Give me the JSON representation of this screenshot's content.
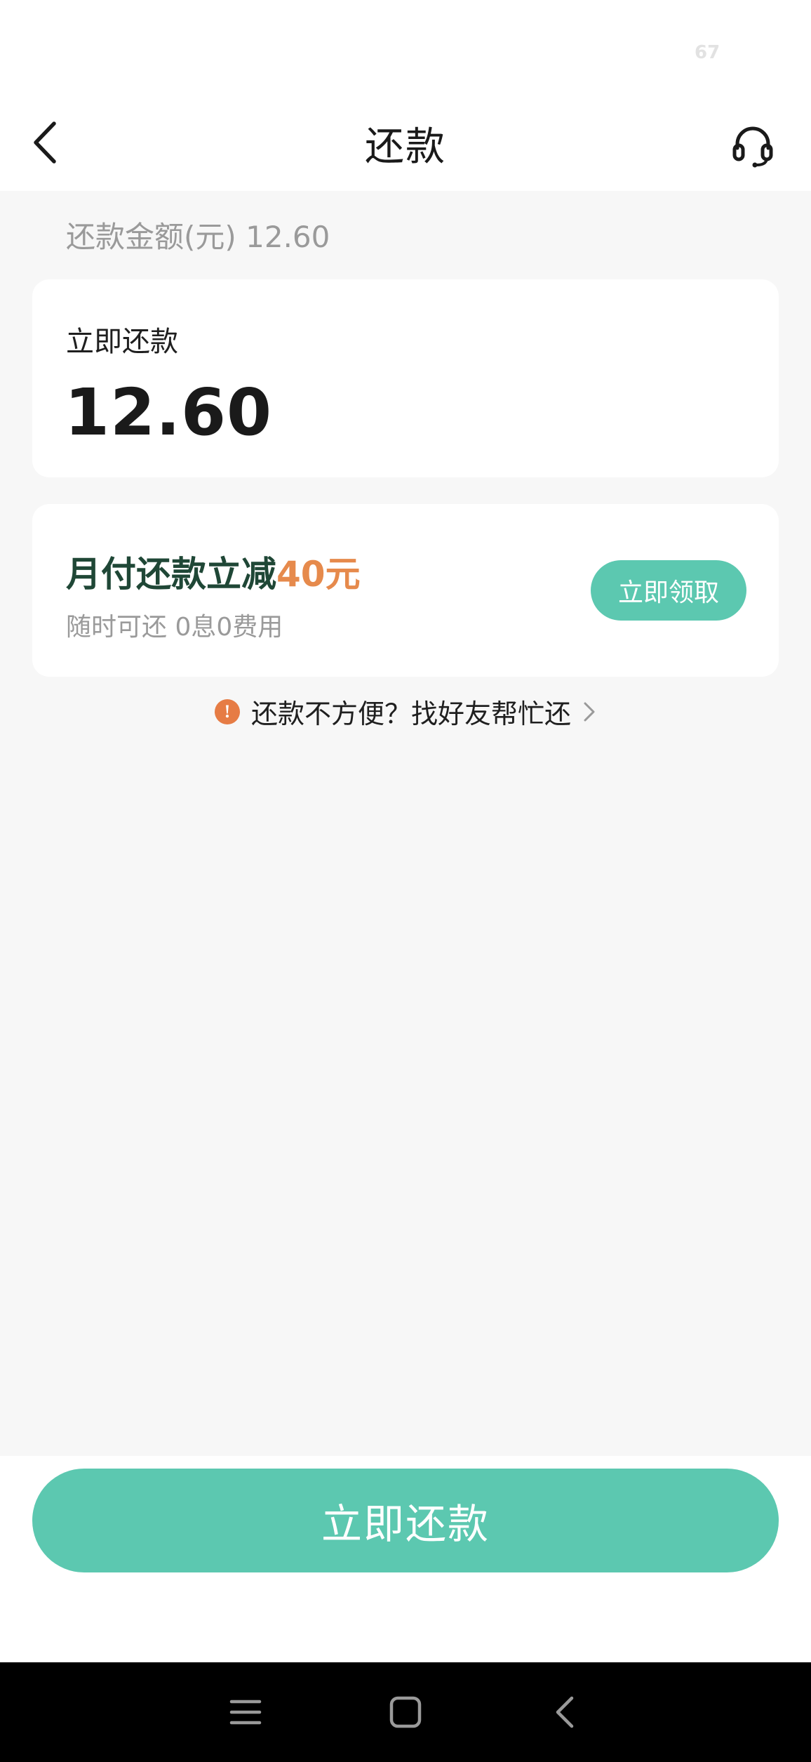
{
  "status_bar": {
    "battery": "67"
  },
  "nav": {
    "title": "还款"
  },
  "summary": {
    "text": "还款金额(元) 12.60"
  },
  "pay_card": {
    "label": "立即还款",
    "amount": "12.60"
  },
  "promo": {
    "title_prefix": "月付还款立减",
    "title_highlight": "40元",
    "subtitle": "随时可还 0息0费用",
    "button_label": "立即领取"
  },
  "friend_help": {
    "icon": "!",
    "text": "还款不方便？找好友帮忙还"
  },
  "footer": {
    "pay_button_label": "立即还款"
  },
  "colors": {
    "accent": "#5cc8b0",
    "promo_highlight": "#e68a4c",
    "promo_title": "#1f4736",
    "info_icon": "#e67c45"
  },
  "icons": {
    "back": "back-chevron-icon",
    "service": "headset-icon",
    "info": "info-icon",
    "chevron": "chevron-right-icon",
    "menu": "menu-icon",
    "home": "home-icon",
    "sys_back": "back-icon"
  }
}
